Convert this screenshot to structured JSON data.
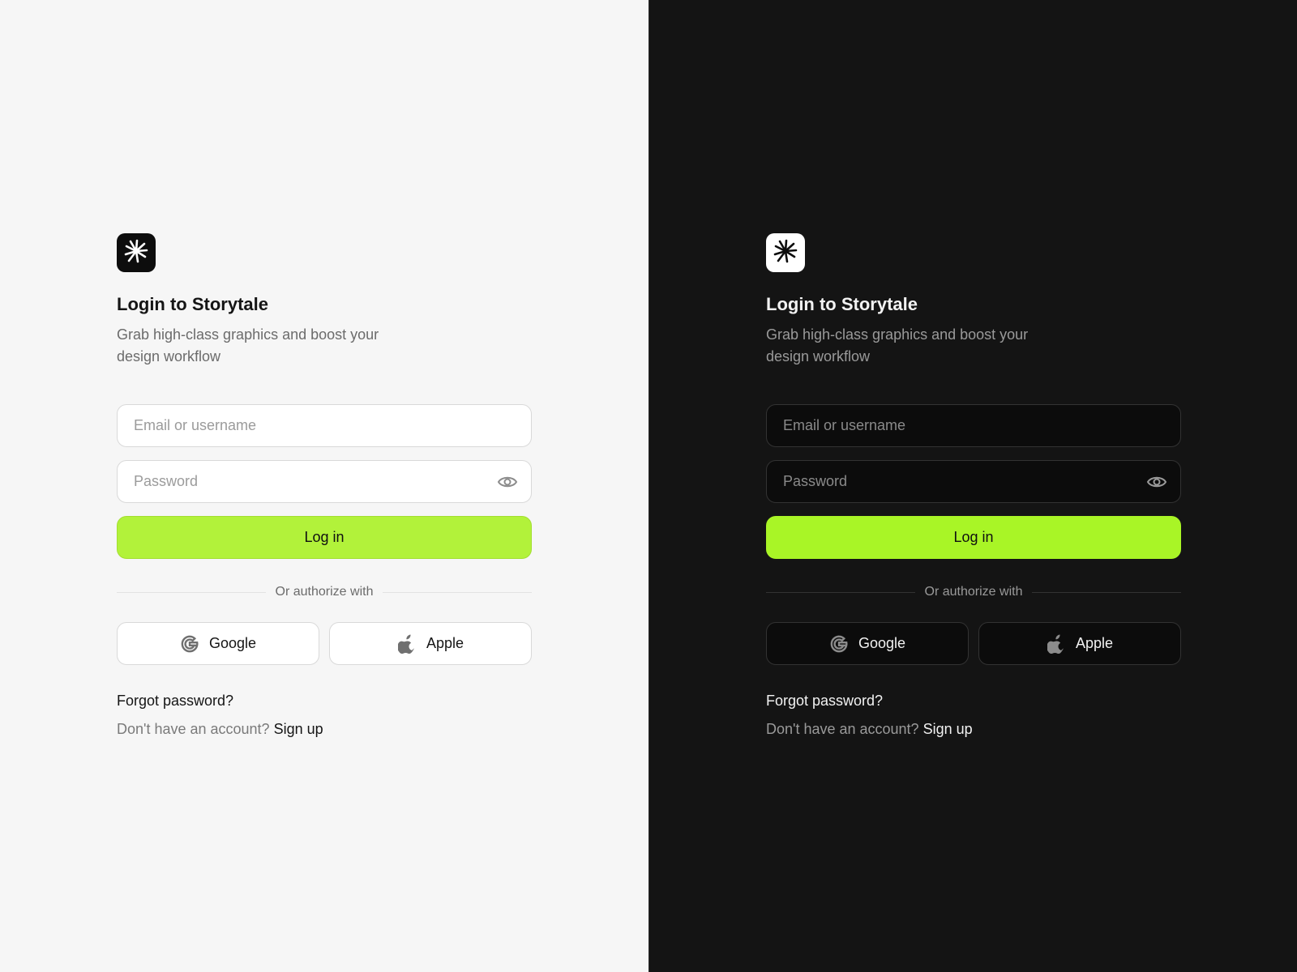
{
  "brand": {
    "logo_icon": "starburst-icon",
    "title": "Login to Storytale",
    "subtitle": "Grab high-class graphics and boost your design workflow"
  },
  "form": {
    "email_placeholder": "Email or username",
    "email_value": "",
    "password_placeholder": "Password",
    "password_value": "",
    "eye_icon": "eye-icon",
    "login_label": "Log in"
  },
  "divider_text": "Or authorize with",
  "social": {
    "google_label": "Google",
    "google_icon": "google-icon",
    "apple_label": "Apple",
    "apple_icon": "apple-icon"
  },
  "footer": {
    "forgot_label": "Forgot password?",
    "no_account_text": "Don't have an account?",
    "signup_label": "Sign up"
  },
  "themes": {
    "light": {
      "background": "#f6f6f6",
      "accent": "#b2f23a"
    },
    "dark": {
      "background": "#141414",
      "accent": "#a9f526"
    }
  }
}
